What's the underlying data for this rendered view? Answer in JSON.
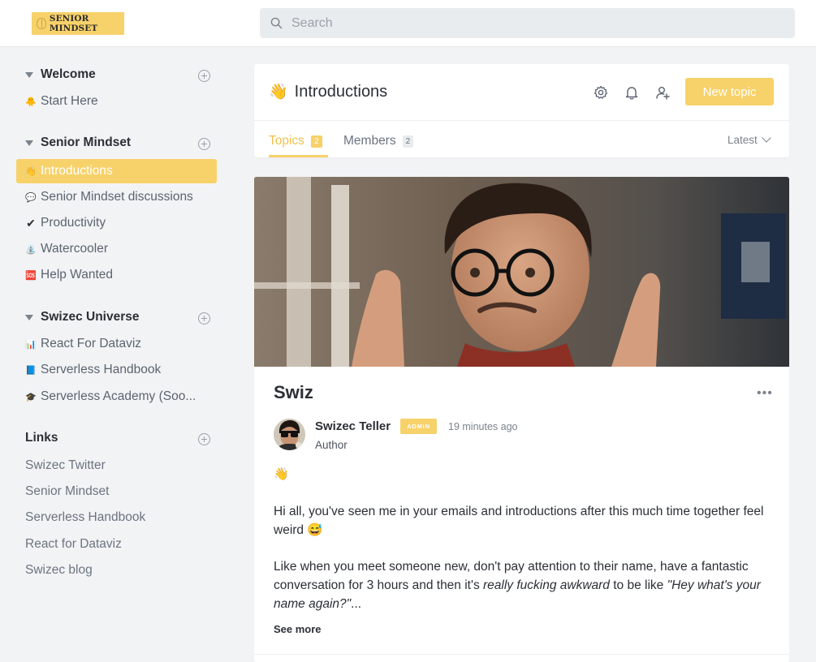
{
  "header": {
    "logo_text": "SENIOR MINDSET",
    "search_placeholder": "Search"
  },
  "sidebar": {
    "sections": [
      {
        "title": "Welcome",
        "items": [
          {
            "emoji": "🐥",
            "label": "Start Here",
            "active": false
          }
        ]
      },
      {
        "title": "Senior Mindset",
        "items": [
          {
            "emoji": "👋",
            "label": "Introductions",
            "active": true
          },
          {
            "emoji": "💬",
            "label": "Senior Mindset discussions",
            "active": false
          },
          {
            "emoji": "✔",
            "label": "Productivity",
            "active": false
          },
          {
            "emoji": "⛲",
            "label": "Watercooler",
            "active": false
          },
          {
            "emoji": "🆘",
            "label": "Help Wanted",
            "active": false
          }
        ]
      },
      {
        "title": "Swizec Universe",
        "items": [
          {
            "emoji": "📊",
            "label": "React For Dataviz",
            "active": false
          },
          {
            "emoji": "📘",
            "label": "Serverless Handbook",
            "active": false
          },
          {
            "emoji": "🎓",
            "label": "Serverless Academy (Soo...",
            "active": false
          }
        ]
      }
    ],
    "links": {
      "title": "Links",
      "items": [
        "Swizec Twitter",
        "Senior Mindset",
        "Serverless Handbook",
        "React for Dataviz",
        "Swizec blog"
      ]
    }
  },
  "channel": {
    "emoji": "👋",
    "title": "Introductions",
    "new_topic_label": "New topic",
    "tabs": [
      {
        "label": "Topics",
        "count": "2"
      },
      {
        "label": "Members",
        "count": "2"
      }
    ],
    "sort_label": "Latest"
  },
  "post": {
    "title": "Swiz",
    "author": "Swizec Teller",
    "badge": "ADMIN",
    "timestamp": "19 minutes ago",
    "role": "Author",
    "wave": "👋",
    "paragraph1": "Hi all, you've seen me in your emails and introductions after this much time together feel weird 😅",
    "paragraph2_start": "Like when you meet someone new, don't pay attention to their name, have a fantastic conversation for 3 hours and then it's ",
    "paragraph2_em": "really fucking awkward",
    "paragraph2_mid": " to be like ",
    "paragraph2_quote": "\"Hey what's your name again?\"",
    "paragraph2_end": "...",
    "see_more": "See more"
  },
  "colors": {
    "accent": "#f7d16a",
    "background": "#f2f3f5",
    "text": "#2b2f36",
    "muted": "#6c7480"
  }
}
